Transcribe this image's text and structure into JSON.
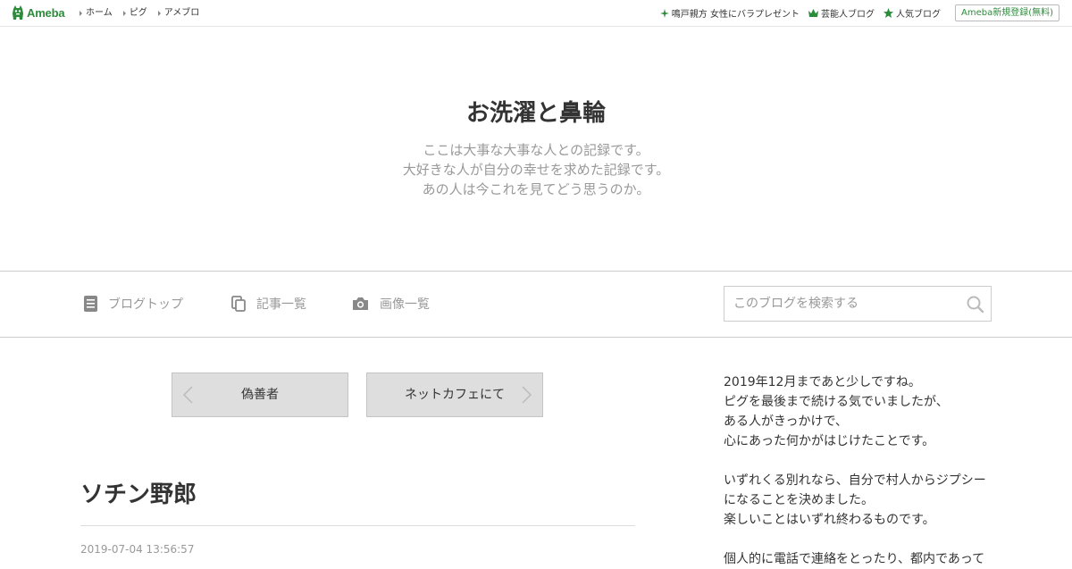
{
  "global_header": {
    "logo_text": "Ameba",
    "nav": [
      "ホーム",
      "ピグ",
      "アメブロ"
    ],
    "links": [
      "鳴戸親方 女性にバラプレゼント",
      "芸能人ブログ",
      "人気ブログ"
    ],
    "register_label": "Ameba新規登録(無料)"
  },
  "blog": {
    "title": "お洗濯と鼻輪",
    "description": [
      "ここは大事な大事な人との記録です。",
      "大好きな人が自分の幸せを求めた記録です。",
      "あの人は今これを見てどう思うのか。"
    ]
  },
  "blog_nav": {
    "items": [
      "ブログトップ",
      "記事一覧",
      "画像一覧"
    ],
    "search_placeholder": "このブログを検索する"
  },
  "pager": {
    "prev": "偽善者",
    "next": "ネットカフェにて"
  },
  "article": {
    "title": "ソチン野郎",
    "date": "2019-07-04 13:56:57"
  },
  "side_profile": {
    "paragraphs": [
      [
        "2019年12月まであと少しですね。",
        "ピグを最後まで続ける気でいましたが、",
        "ある人がきっかけで、",
        "心にあった何かがはじけたことです。"
      ],
      [
        "いずれくる別れなら、自分で村人からジプシー",
        "になることを決めました。",
        "楽しいことはいずれ終わるものです。"
      ],
      [
        "個人的に電話で連絡をとったり、都内であって"
      ]
    ]
  },
  "colors": {
    "brand": "#2d8c3c",
    "pager_bg": "#dedede",
    "muted_text": "#999999"
  }
}
